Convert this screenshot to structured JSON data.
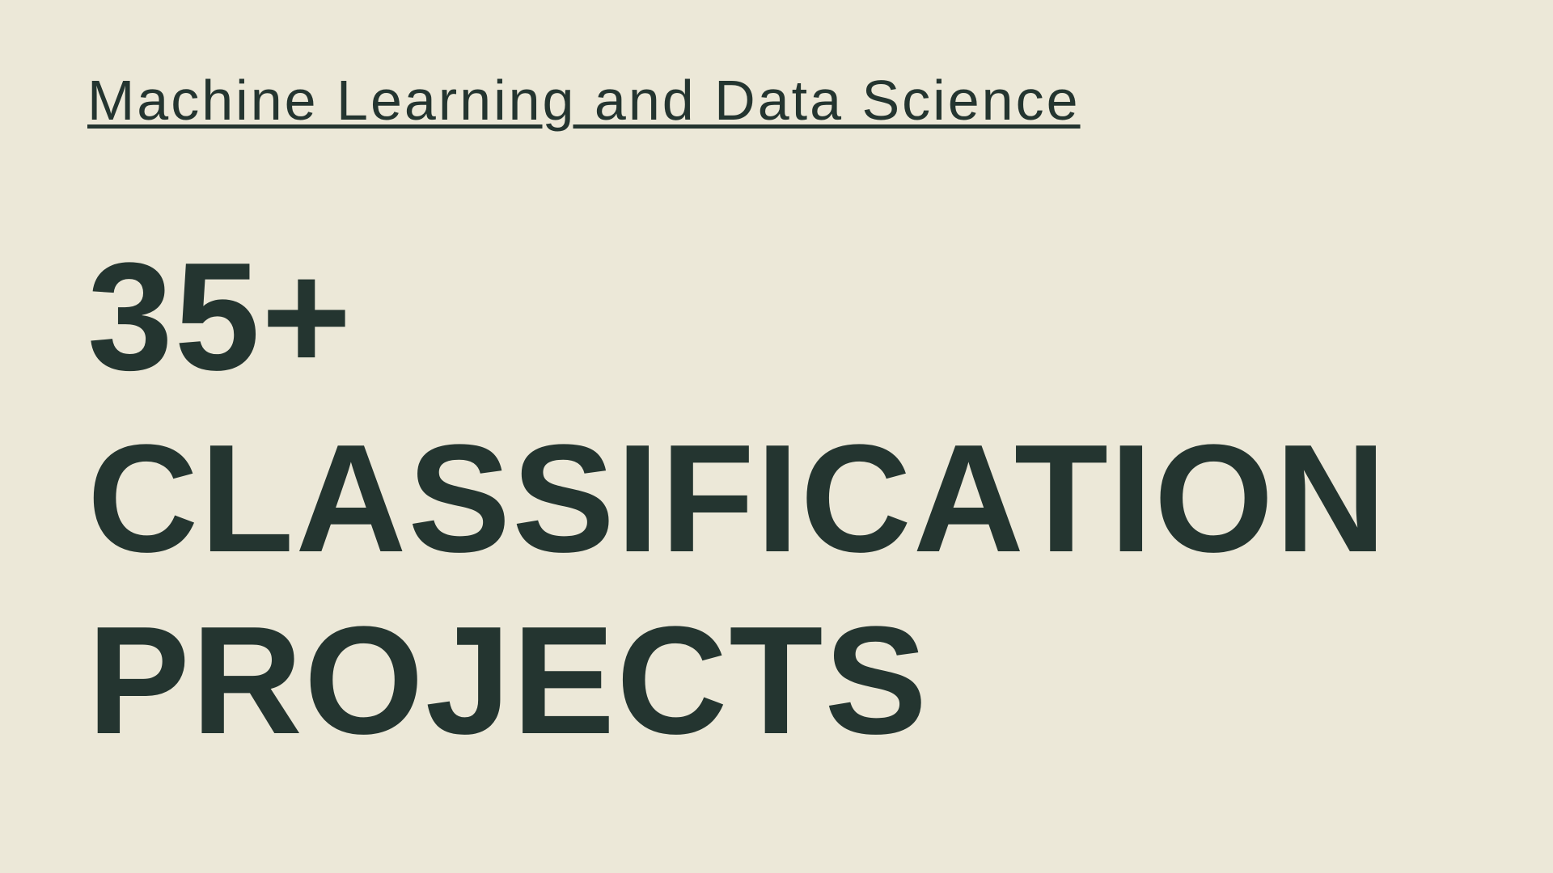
{
  "slide": {
    "subtitle": "Machine Learning and Data Science",
    "headline_lines": [
      "35+",
      "CLASSIFICATION",
      "PROJECTS"
    ]
  },
  "colors": {
    "background": "#ece8d8",
    "text": "#243530"
  }
}
